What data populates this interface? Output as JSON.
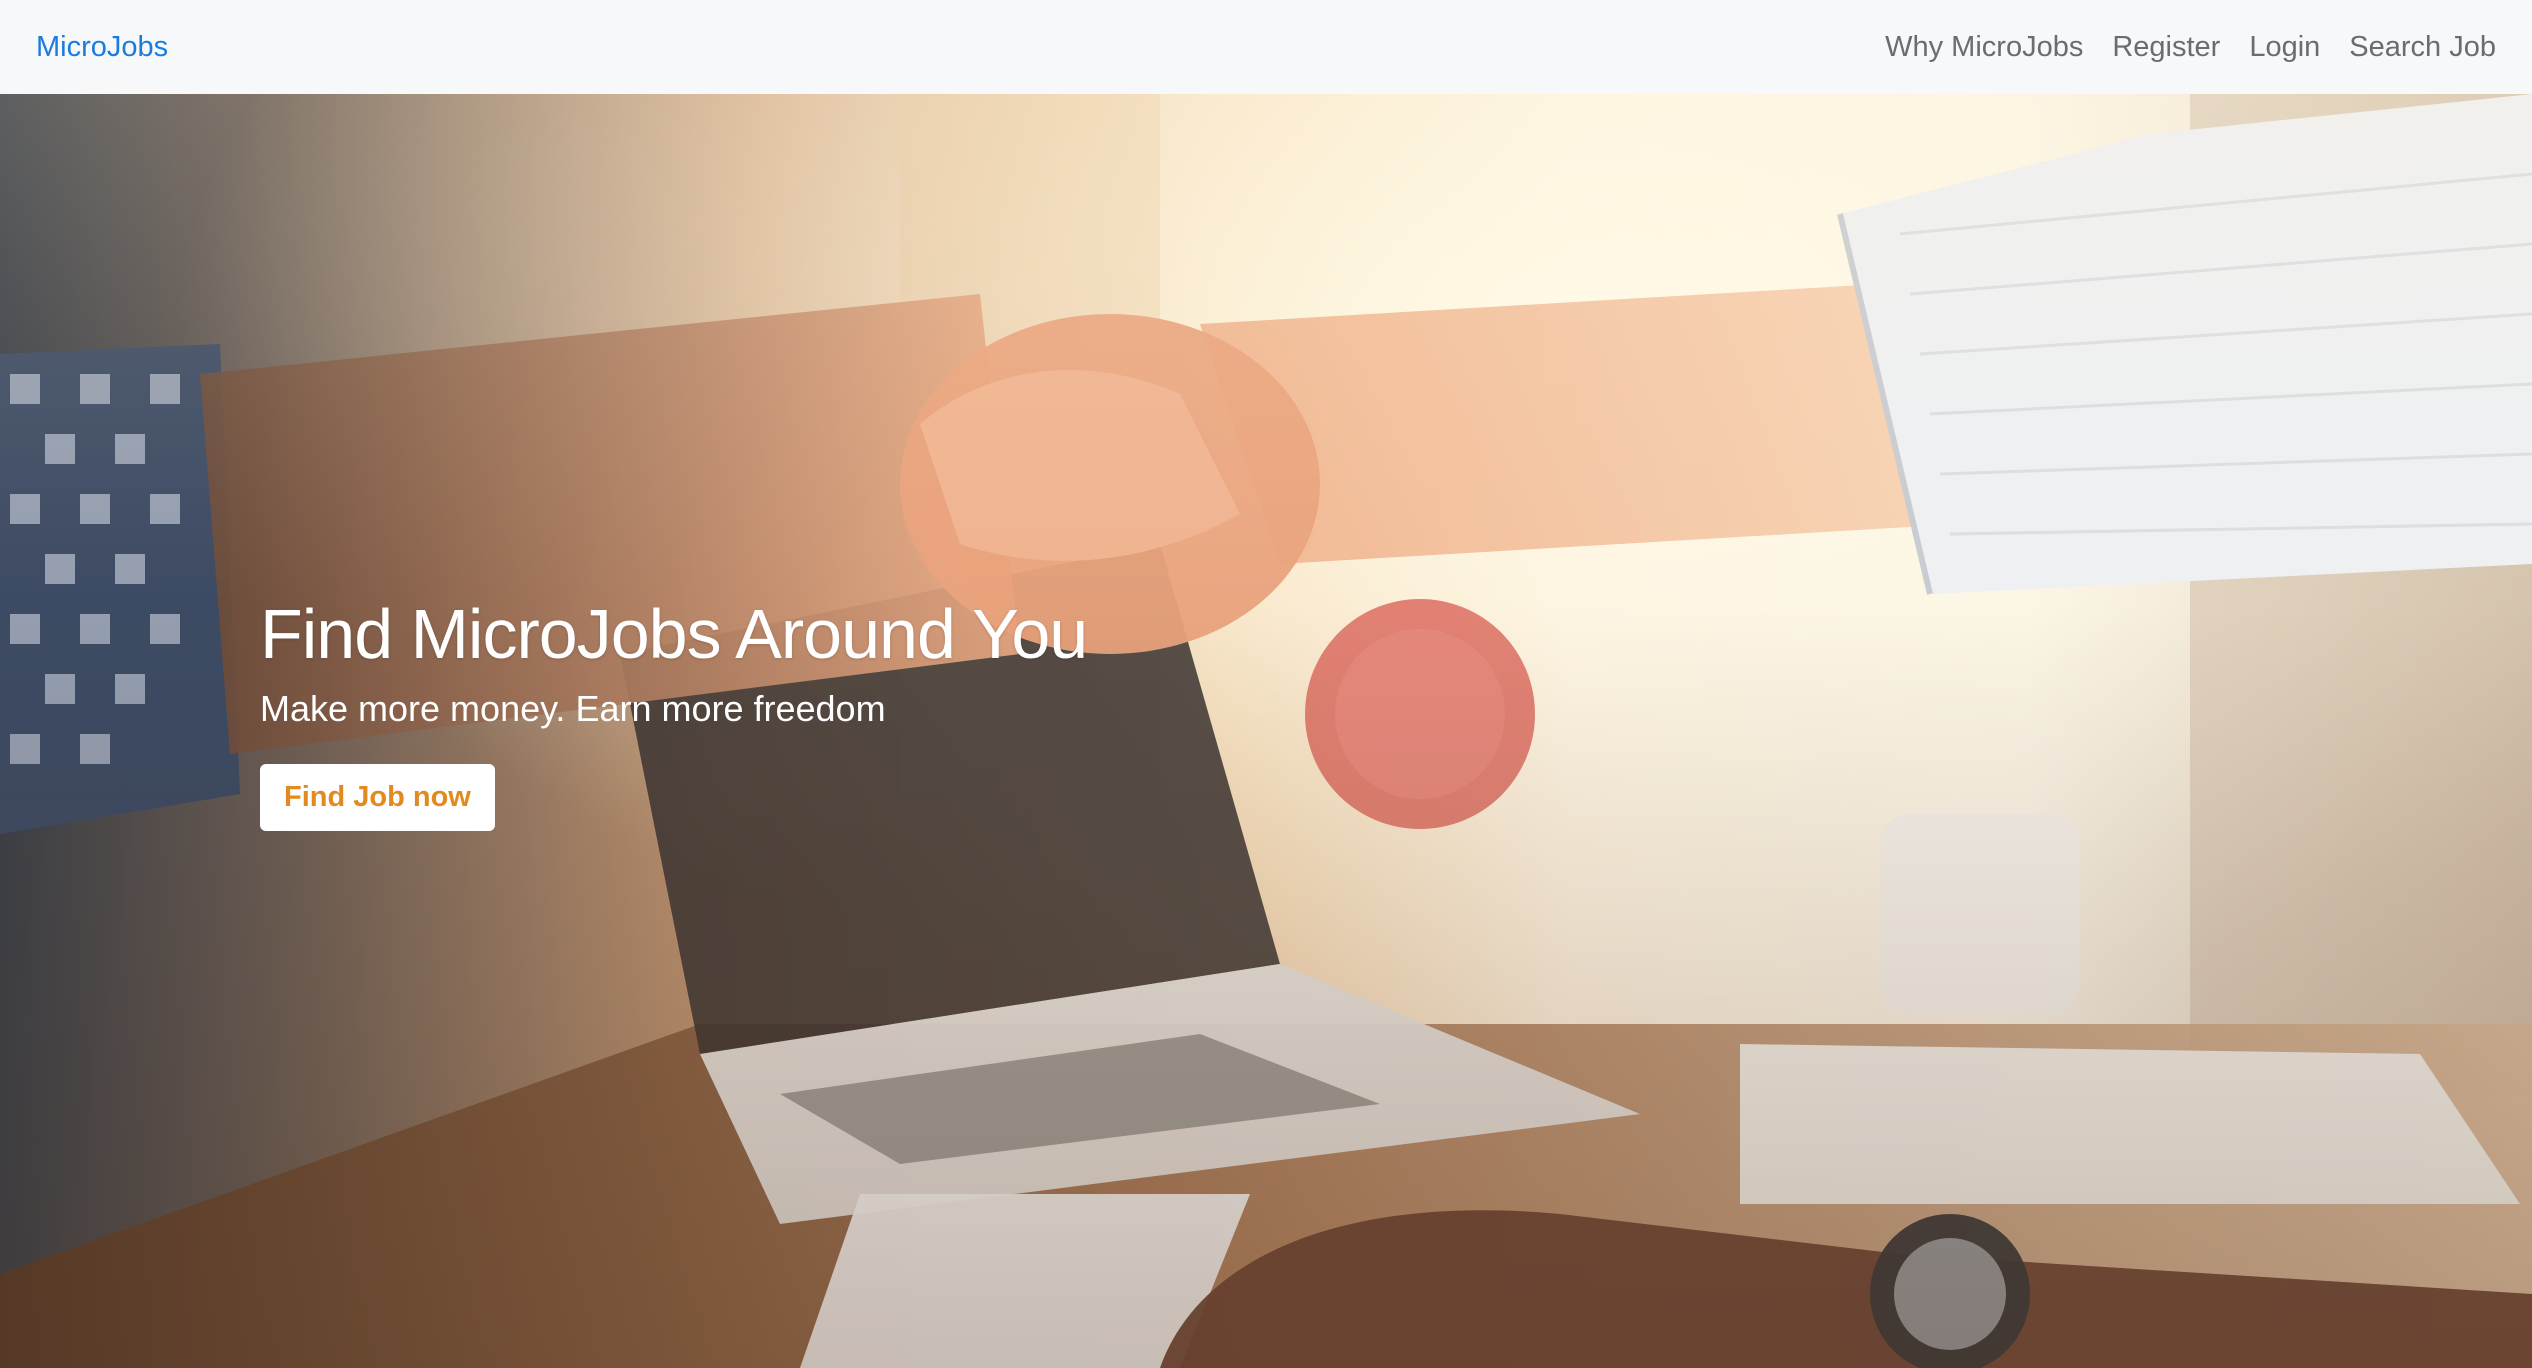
{
  "navbar": {
    "brand": "MicroJobs",
    "links": [
      {
        "label": "Why MicroJobs"
      },
      {
        "label": "Register"
      },
      {
        "label": "Login"
      },
      {
        "label": "Search Job"
      }
    ]
  },
  "hero": {
    "title": "Find MicroJobs Around You",
    "subtitle": "Make more money. Earn more freedom",
    "cta_label": "Find Job now",
    "background_image": "handshake-photo"
  },
  "colors": {
    "brand": "#1a7cdd",
    "nav_link": "#6a6d70",
    "navbar_bg": "#f7f8fa",
    "cta_text": "#e28a1f",
    "hero_text": "#ffffff"
  }
}
